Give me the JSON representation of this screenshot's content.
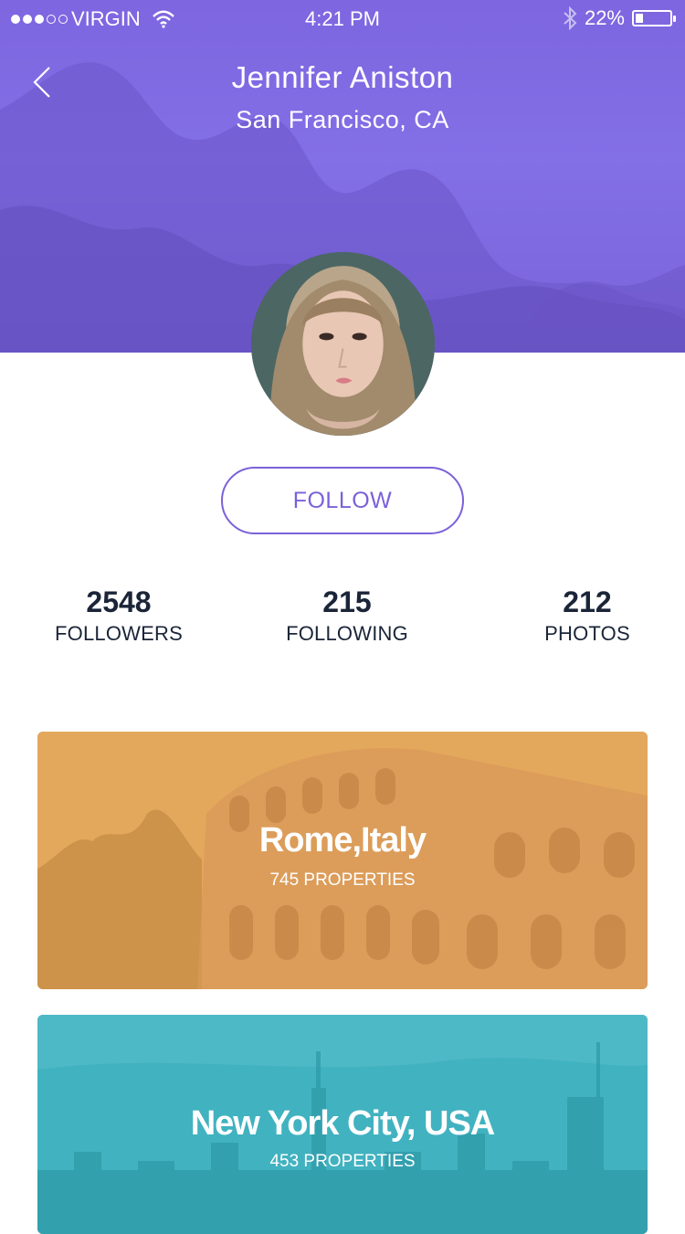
{
  "status_bar": {
    "carrier": "VIRGIN",
    "time": "4:21 PM",
    "battery": "22%",
    "battery_level": 0.22,
    "signal_bars_filled": 3,
    "signal_bars_total": 5
  },
  "profile": {
    "name": "Jennifer Aniston",
    "location": "San Francisco,  CA",
    "follow_label": "FOLLOW"
  },
  "stats": [
    {
      "value": "2548",
      "label": "FOLLOWERS"
    },
    {
      "value": "215",
      "label": "FOLLOWING"
    },
    {
      "value": "212",
      "label": "PHOTOS"
    }
  ],
  "cards": [
    {
      "title": "Rome,Italy",
      "subtitle": "745 PROPERTIES",
      "color": "#e6a458"
    },
    {
      "title": "New York City, USA",
      "subtitle": "453 PROPERTIES",
      "color": "#3ab0bf"
    }
  ],
  "colors": {
    "accent": "#7b61d9",
    "header": "#7d66e0",
    "stat_text": "#1b2538"
  },
  "icons": {
    "back": "chevron-left-icon",
    "wifi": "wifi-icon",
    "bluetooth": "bluetooth-icon",
    "battery": "battery-icon"
  }
}
